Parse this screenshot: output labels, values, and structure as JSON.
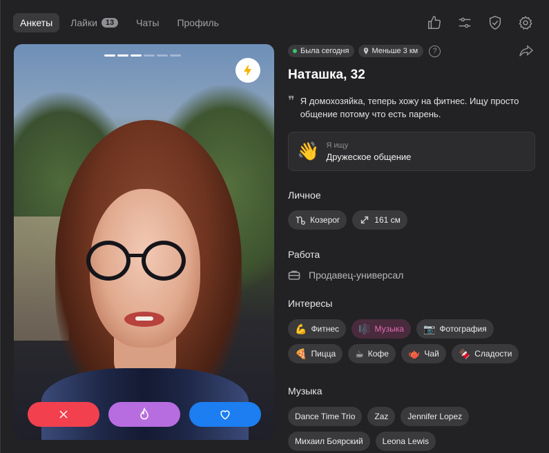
{
  "nav": {
    "tabs": [
      {
        "label": "Анкеты",
        "active": true
      },
      {
        "label": "Лайки",
        "badge": "13"
      },
      {
        "label": "Чаты"
      },
      {
        "label": "Профиль"
      }
    ],
    "icons": [
      "thumbs-up-icon",
      "sliders-icon",
      "shield-check-icon",
      "gear-icon"
    ]
  },
  "photo": {
    "pages_total": 6,
    "pages_active": 3,
    "boost_icon": "lightning-icon"
  },
  "actions": {
    "dislike_icon": "close-icon",
    "superlike_icon": "flame-icon",
    "like_icon": "heart-icon",
    "colors": {
      "dislike": "#f2404f",
      "superlike": "#b76de0",
      "like": "#1c7ef0"
    }
  },
  "profile": {
    "status": "Была сегодня",
    "distance": "Меньше 3 км",
    "help": "?",
    "name": "Наташка, 32",
    "bio_quote": "❞",
    "bio": "Я домохозяйка, теперь хожу на фитнес. Ищу просто общение потому что есть парень.",
    "seeking": {
      "emoji": "👋",
      "label": "Я ищу",
      "value": "Дружеское общение"
    },
    "personal": {
      "title": "Личное",
      "items": [
        {
          "icon": "capricorn-icon",
          "label": "Козерог"
        },
        {
          "icon": "height-icon",
          "label": "161 см"
        }
      ]
    },
    "work": {
      "title": "Работа",
      "value": "Продавец-универсал"
    },
    "interests": {
      "title": "Интересы",
      "items": [
        {
          "emoji": "💪",
          "label": "Фитнес"
        },
        {
          "emoji": "🎼",
          "label": "Музыка",
          "highlight": true
        },
        {
          "emoji": "📷",
          "label": "Фотография"
        },
        {
          "emoji": "🍕",
          "label": "Пицца"
        },
        {
          "emoji": "☕",
          "label": "Кофе"
        },
        {
          "emoji": "🫖",
          "label": "Чай"
        },
        {
          "emoji": "🍫",
          "label": "Сладости"
        }
      ]
    },
    "music": {
      "title": "Музыка",
      "items": [
        "Dance Time Trio",
        "Zaz",
        "Jennifer Lopez",
        "Михаил Боярский",
        "Leona Lewis"
      ]
    }
  }
}
